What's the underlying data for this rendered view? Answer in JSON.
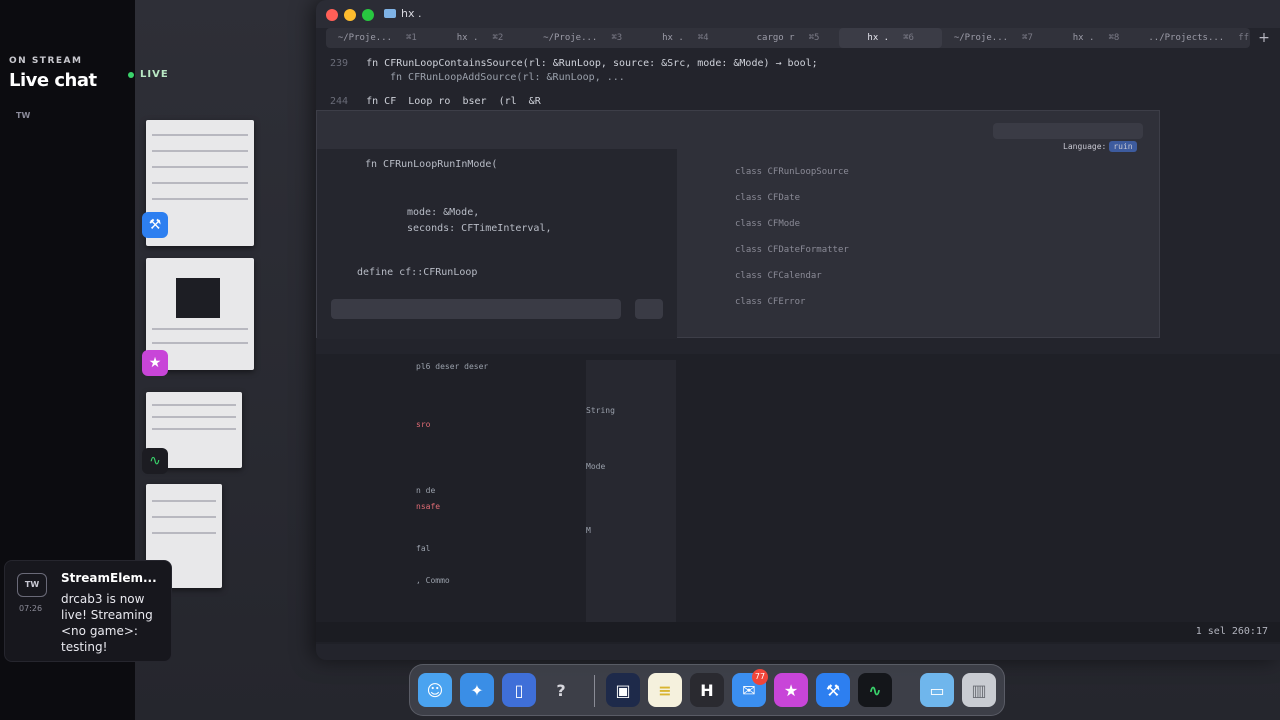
{
  "stream": {
    "on_stream": "ON STREAM",
    "title": "Live chat",
    "live": "LIVE",
    "tw": "TW",
    "notification": {
      "avatar": "TW",
      "time": "07:26",
      "name": "StreamElem...",
      "message": "drcab3 is now live! Streaming <no game>: testing!"
    }
  },
  "window": {
    "title": "hx .",
    "tabs": [
      {
        "label": "~/Proje...",
        "key": "⌘1"
      },
      {
        "label": "hx .",
        "key": "⌘2"
      },
      {
        "label": "~/Proje...",
        "key": "⌘3"
      },
      {
        "label": "hx .",
        "key": "⌘4"
      },
      {
        "label": "cargo r",
        "key": "⌘5"
      },
      {
        "label": "hx .",
        "key": "⌘6"
      },
      {
        "label": "~/Proje...",
        "key": "⌘7"
      },
      {
        "label": "hx .",
        "key": "⌘8"
      },
      {
        "label": "../Projects...",
        "key": "ff"
      }
    ],
    "add_tab": "+",
    "code_lines": [
      {
        "num": "239",
        "text": "fn CFRunLoopContainsSource(rl: &RunLoop, source: &Src, mode: &Mode) → bool;"
      },
      {
        "num": "",
        "text": "fn CFRunLoopAddSource(rl: &RunLoop, ..."
      },
      {
        "num": "244",
        "text": "fn CF  Loop ro  bser  (rl  &R"
      }
    ],
    "popup_lang": "Language:",
    "popup_lang_value": "ruin",
    "symbols": [
      "class CFRunLoopSource",
      "class CFDate",
      "class CFMode",
      "class CFDateFormatter",
      "class CFCalendar",
      "class CFError"
    ],
    "left_code": [
      "fn CFRunLoopRunInMode(",
      "mode: &Mode,",
      "seconds: CFTimeInterval,",
      "define cf::CFRunLoop"
    ],
    "status": "1 sel  260:17"
  },
  "dock": {
    "badge": "77",
    "apps": [
      "finder-icon",
      "safari-icon",
      "files-icon",
      "help-icon",
      "terminal-icon",
      "notes-icon",
      "helix-icon",
      "mail-icon",
      "star-icon",
      "xcode-icon",
      "activity-icon",
      "folder-icon",
      "trash-icon"
    ]
  }
}
